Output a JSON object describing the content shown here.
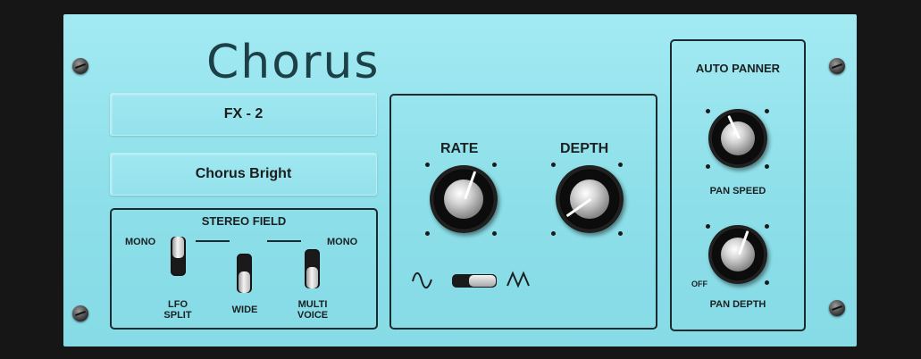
{
  "plugin": {
    "title": "Chorus"
  },
  "displays": {
    "slot": "FX - 2",
    "preset": "Chorus Bright"
  },
  "stereo_field": {
    "heading": "STEREO FIELD",
    "mono_left": "MONO",
    "mono_right": "MONO",
    "lfo_split_line1": "LFO",
    "lfo_split_line2": "SPLIT",
    "wide": "WIDE",
    "multi_voice_line1": "MULTI",
    "multi_voice_line2": "VOICE"
  },
  "lfo": {
    "rate_label": "RATE",
    "depth_label": "DEPTH",
    "wave_sine_icon": "sine-wave-icon",
    "wave_triangle_icon": "triangle-wave-icon",
    "wave_switch_position": "triangle"
  },
  "auto_panner": {
    "heading": "AUTO PANNER",
    "pan_speed_label": "PAN SPEED",
    "pan_depth_label": "PAN DEPTH",
    "pan_depth_min_label": "OFF"
  },
  "colors": {
    "panel": "#8fe3ee",
    "text": "#1b2022",
    "background": "#161616"
  }
}
